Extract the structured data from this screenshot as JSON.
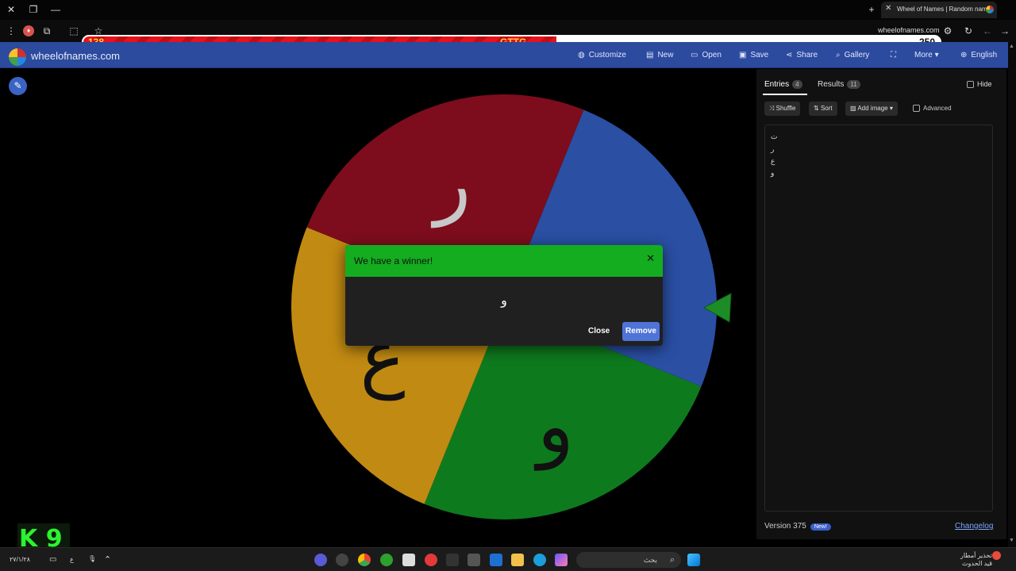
{
  "browser": {
    "tab_title": "Wheel of Names | Random nam",
    "address": "wheelofnames.com"
  },
  "overlay": {
    "left_value": "138",
    "center_text": "GTTG",
    "right_value": "250",
    "fill_fraction": 0.552,
    "fill_color": "#e8121a"
  },
  "app": {
    "brand": "wheelofnames.com",
    "menu": [
      {
        "label": "Customize",
        "icon": "palette-icon"
      },
      {
        "label": "New",
        "icon": "file-icon"
      },
      {
        "label": "Open",
        "icon": "folder-icon"
      },
      {
        "label": "Save",
        "icon": "save-icon"
      },
      {
        "label": "Share",
        "icon": "share-icon"
      },
      {
        "label": "Gallery",
        "icon": "search-icon"
      },
      {
        "label": "",
        "icon": "fullscreen-icon"
      },
      {
        "label": "More",
        "icon": "chevron-down-icon"
      },
      {
        "label": "English",
        "icon": "globe-icon"
      }
    ],
    "accent": "#2c4a9e"
  },
  "wheel": {
    "segments": [
      {
        "label": "ت",
        "color": "#2a4fa3"
      },
      {
        "label": "و",
        "color": "#0e7a1e"
      },
      {
        "label": "ع",
        "color": "#c18a12"
      },
      {
        "label": "ر",
        "color": "#7d0d1c"
      }
    ]
  },
  "dialog": {
    "title": "We have a winner!",
    "winner": "و",
    "close_label": "Close",
    "remove_label": "Remove",
    "header_color": "#13ad1f"
  },
  "panel": {
    "tab_entries": "Entries",
    "tab_entries_count": "4",
    "tab_results": "Results",
    "tab_results_count": "11",
    "hide_label": "Hide",
    "shuffle_label": "Shuffle",
    "sort_label": "Sort",
    "add_image_label": "Add image",
    "advanced_label": "Advanced",
    "entries": [
      "ت",
      "ر",
      "ع",
      "و"
    ],
    "version": "Version 375",
    "new_badge": "New!",
    "changelog": "Changelog"
  },
  "taskbar": {
    "search_placeholder": "بحث",
    "tray_text_1": "تحذير أمطار",
    "tray_text_2": "قيد الحدوث",
    "lang": "ع",
    "watermark": "K 9"
  }
}
